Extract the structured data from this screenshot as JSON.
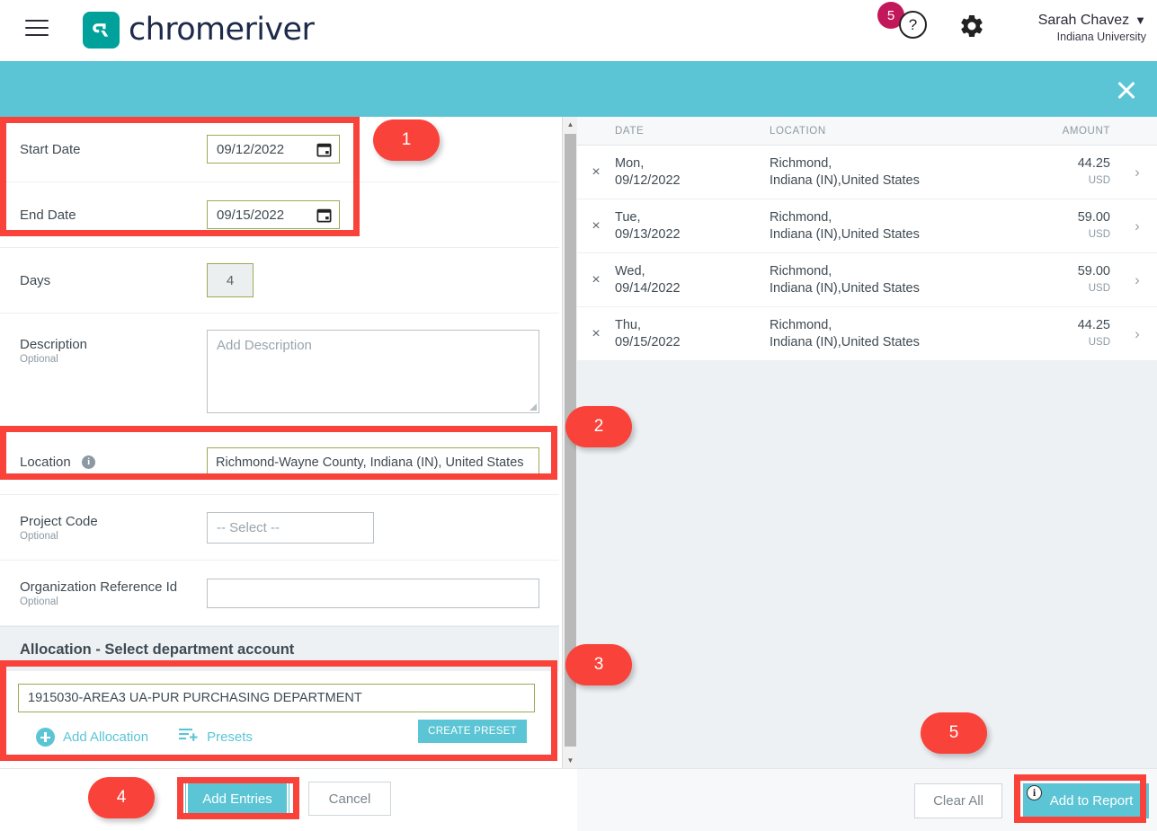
{
  "header": {
    "menu_icon": "hamburger-menu-icon",
    "brand": "chromeriver",
    "notification_count": "5",
    "help_icon": "?",
    "gear_icon": "gear-icon",
    "user_name": "Sarah Chavez",
    "user_caret": "⌄",
    "user_org": "Indiana University"
  },
  "banner": {
    "close_icon": "close-icon"
  },
  "form": {
    "start_date": {
      "label": "Start Date",
      "value": "09/12/2022"
    },
    "end_date": {
      "label": "End Date",
      "value": "09/15/2022"
    },
    "days": {
      "label": "Days",
      "value": "4"
    },
    "description": {
      "label": "Description",
      "optional": "Optional",
      "placeholder": "Add Description",
      "value": ""
    },
    "location": {
      "label": "Location",
      "info_icon": "i",
      "value": "Richmond-Wayne County, Indiana (IN), United States"
    },
    "project_code": {
      "label": "Project Code",
      "optional": "Optional",
      "value": "-- Select --"
    },
    "org_ref_id": {
      "label": "Organization Reference Id",
      "optional": "Optional",
      "value": ""
    }
  },
  "allocation": {
    "heading": "Allocation - Select department account",
    "value": "1915030-AREA3 UA-PUR PURCHASING DEPARTMENT",
    "add_allocation": "Add Allocation",
    "presets": "Presets",
    "create_preset": "CREATE PRESET"
  },
  "left_footer": {
    "add_entries": "Add Entries",
    "cancel": "Cancel"
  },
  "table": {
    "columns": [
      "DATE",
      "LOCATION",
      "AMOUNT"
    ],
    "rows": [
      {
        "remove_icon": "×",
        "day": "Mon,",
        "date": "09/12/2022",
        "city": "Richmond,",
        "region": "Indiana (IN),United States",
        "amount": "44.25",
        "currency": "USD",
        "chevron": "›"
      },
      {
        "remove_icon": "×",
        "day": "Tue,",
        "date": "09/13/2022",
        "city": "Richmond,",
        "region": "Indiana (IN),United States",
        "amount": "59.00",
        "currency": "USD",
        "chevron": "›"
      },
      {
        "remove_icon": "×",
        "day": "Wed,",
        "date": "09/14/2022",
        "city": "Richmond,",
        "region": "Indiana (IN),United States",
        "amount": "59.00",
        "currency": "USD",
        "chevron": "›"
      },
      {
        "remove_icon": "×",
        "day": "Thu,",
        "date": "09/15/2022",
        "city": "Richmond,",
        "region": "Indiana (IN),United States",
        "amount": "44.25",
        "currency": "USD",
        "chevron": "›"
      }
    ]
  },
  "right_footer": {
    "clear_all": "Clear All",
    "add_to_report": "Add to Report",
    "info_icon": "i"
  },
  "callouts": [
    {
      "number": "1"
    },
    {
      "number": "2"
    },
    {
      "number": "3"
    },
    {
      "number": "4"
    },
    {
      "number": "5"
    }
  ],
  "colors": {
    "teal": "#5bc5d6",
    "brand_teal": "#00a19a",
    "annotation_red": "#f9423a",
    "badge_magenta": "#c2185b",
    "field_green": "#9aab55"
  }
}
